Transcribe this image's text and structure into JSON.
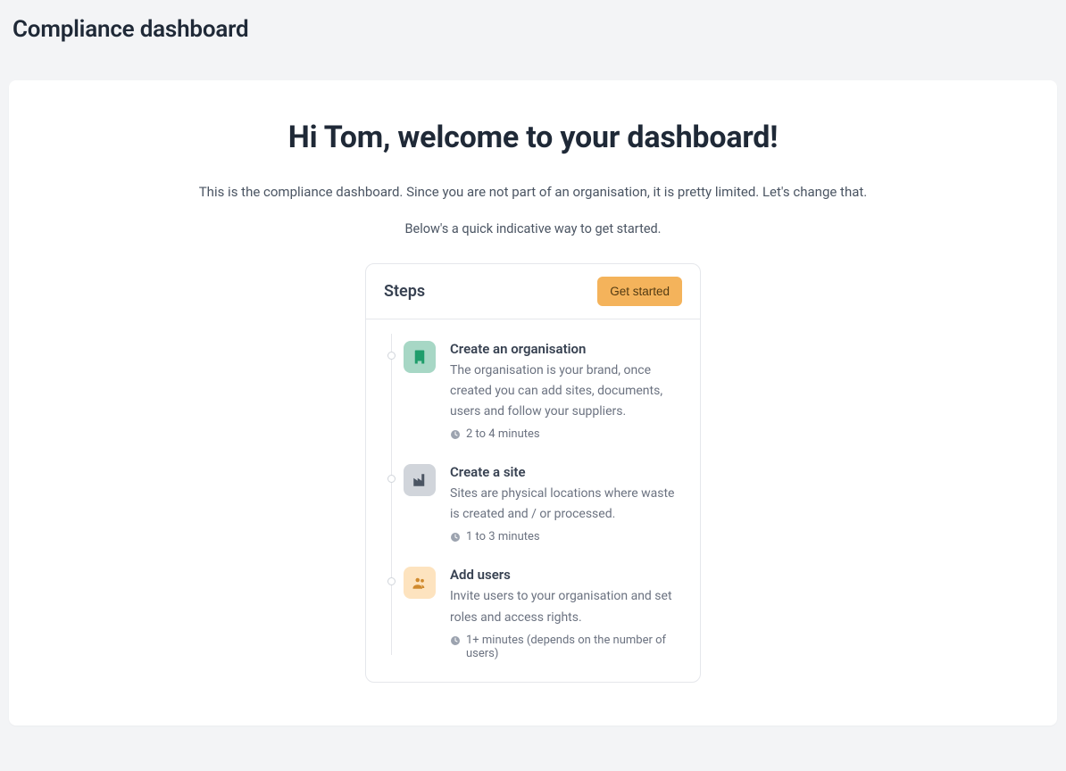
{
  "page_title": "Compliance dashboard",
  "welcome": {
    "heading": "Hi Tom, welcome to your dashboard!",
    "sub1": "This is the compliance dashboard. Since you are not part of an organisation, it is pretty limited. Let's change that.",
    "sub2": "Below's a quick indicative way to get started."
  },
  "steps": {
    "title": "Steps",
    "cta_label": "Get started",
    "items": [
      {
        "title": "Create an organisation",
        "description": "The organisation is your brand, once created you can add sites, documents, users and follow your suppliers.",
        "time": "2 to 4 minutes"
      },
      {
        "title": "Create a site",
        "description": "Sites are physical locations where waste is created and / or processed.",
        "time": "1 to 3 minutes"
      },
      {
        "title": "Add users",
        "description": "Invite users to your organisation and set roles and access rights.",
        "time": "1+ minutes (depends on the number of users)"
      }
    ]
  }
}
